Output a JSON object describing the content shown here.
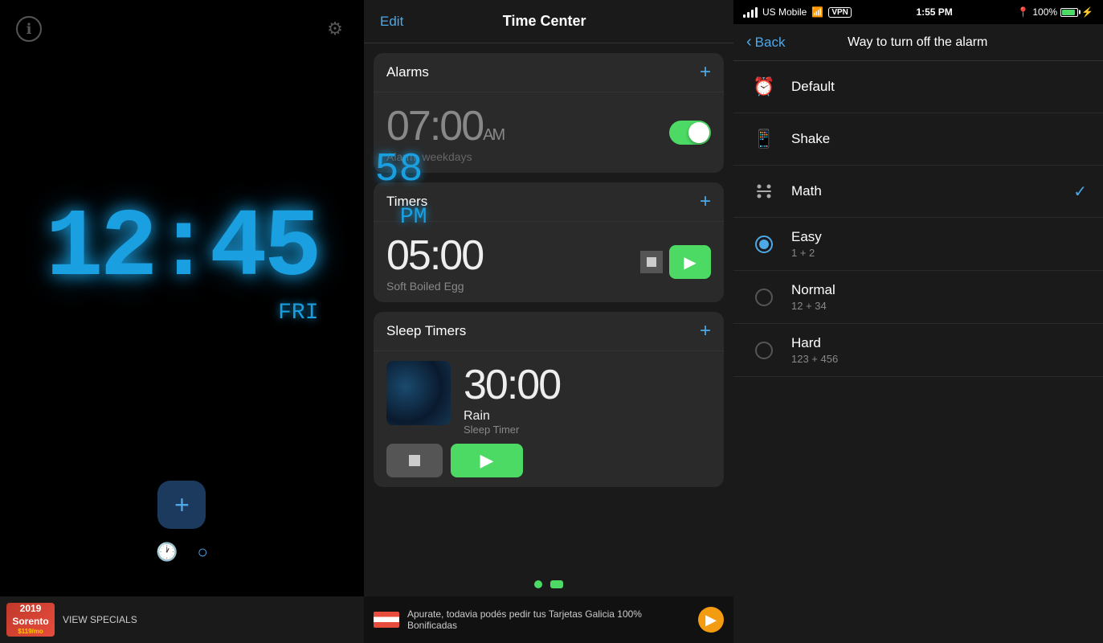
{
  "left": {
    "info_label": "ℹ",
    "settings_label": "⚙",
    "time": "12:45",
    "seconds": "58",
    "am_pm": "PM",
    "day": "FRI",
    "add_label": "+",
    "nav_clock": "🕐",
    "nav_circle": "○",
    "ad": {
      "year": "2019 Sorento",
      "price": "$119/mo",
      "cta": "VIEW SPECIALS"
    }
  },
  "middle": {
    "header": {
      "edit_label": "Edit",
      "title": "Time Center"
    },
    "alarms": {
      "section_title": "Alarms",
      "add_label": "+",
      "items": [
        {
          "time": "07:00",
          "am_pm": "AM",
          "subtitle": "Alarm, weekdays",
          "enabled": true
        }
      ]
    },
    "timers": {
      "section_title": "Timers",
      "add_label": "+",
      "items": [
        {
          "time": "05:00",
          "subtitle": "Soft Boiled Egg"
        }
      ]
    },
    "sleep_timers": {
      "section_title": "Sleep Timers",
      "add_label": "+",
      "items": [
        {
          "time": "30:00",
          "name": "Rain",
          "subtitle": "Sleep Timer"
        }
      ]
    },
    "dots": [
      "circle",
      "lines"
    ],
    "ad": {
      "text": "Apurate, todavia podés pedir tus Tarjetas Galicia 100% Bonificadas",
      "cta": "▶"
    }
  },
  "right": {
    "status": {
      "carrier": "US Mobile",
      "wifi": "wifi",
      "vpn": "VPN",
      "time": "1:55 PM",
      "location": "loc",
      "battery": "100%"
    },
    "nav": {
      "back_label": "Back",
      "title": "Way to turn off the alarm"
    },
    "items": [
      {
        "id": "default",
        "icon": "alarm",
        "label": "Default",
        "sublabel": "",
        "type": "simple",
        "checked": false
      },
      {
        "id": "shake",
        "icon": "phone",
        "label": "Shake",
        "sublabel": "",
        "type": "simple",
        "checked": false
      },
      {
        "id": "math",
        "icon": "math",
        "label": "Math",
        "sublabel": "",
        "type": "checkmark",
        "checked": true
      },
      {
        "id": "easy",
        "icon": "radio",
        "label": "Easy",
        "sublabel": "1 + 2",
        "type": "radio",
        "checked": true
      },
      {
        "id": "normal",
        "icon": "radio",
        "label": "Normal",
        "sublabel": "12 + 34",
        "type": "radio",
        "checked": false
      },
      {
        "id": "hard",
        "icon": "radio",
        "label": "Hard",
        "sublabel": "123 + 456",
        "type": "radio",
        "checked": false
      }
    ]
  }
}
